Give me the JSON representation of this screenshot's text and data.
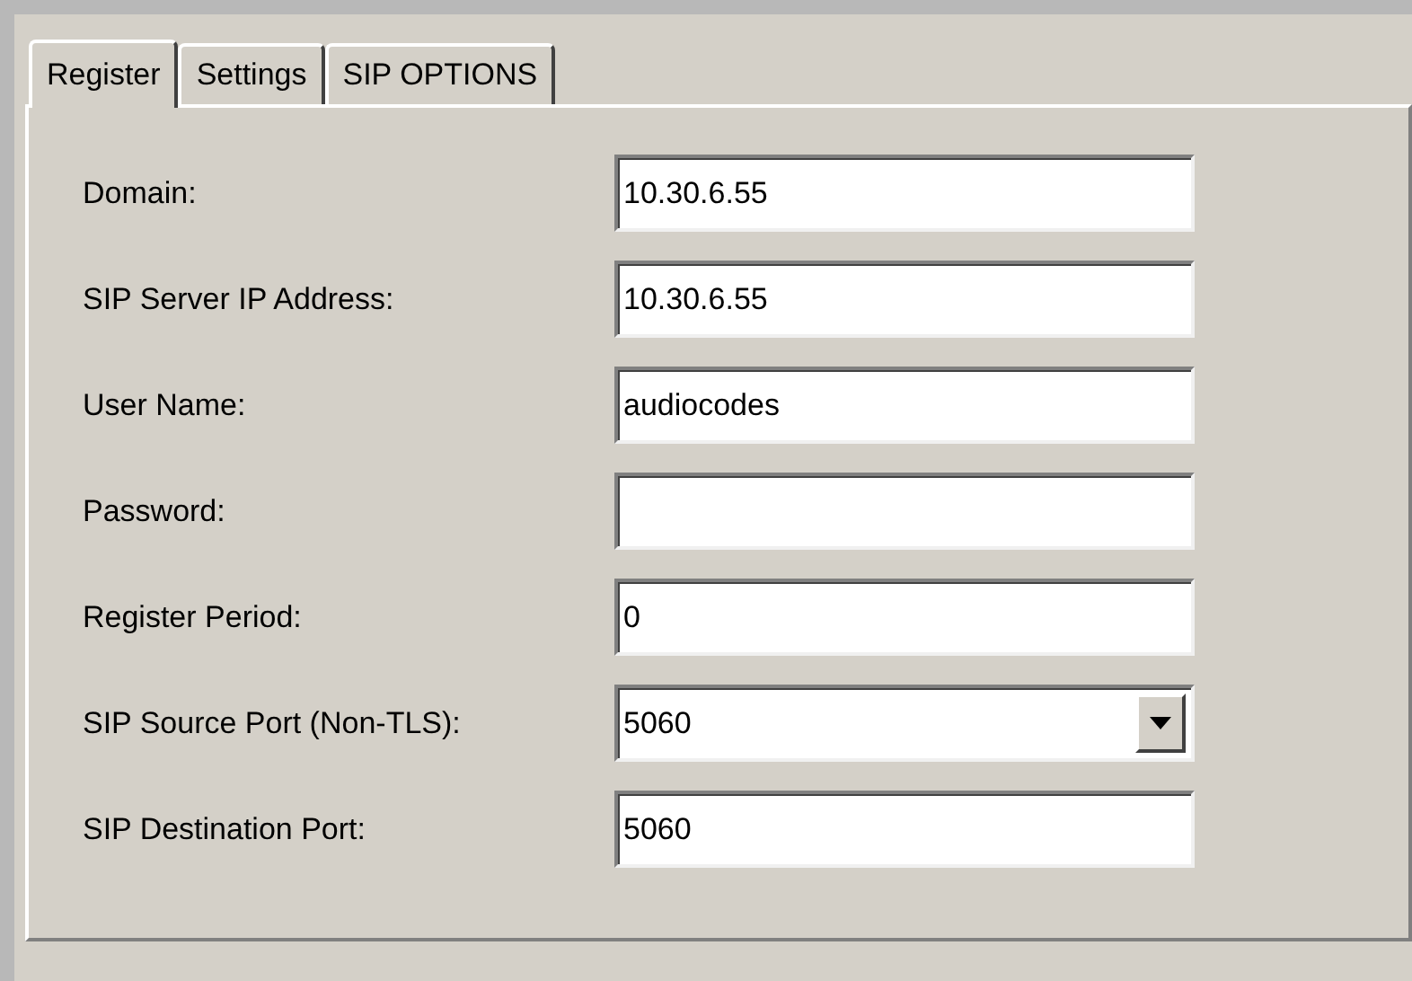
{
  "tabs": [
    {
      "label": "Register",
      "selected": true
    },
    {
      "label": "Settings",
      "selected": false
    },
    {
      "label": "SIP OPTIONS",
      "selected": false
    }
  ],
  "fields": [
    {
      "label": "Domain:",
      "value": "10.30.6.55",
      "kind": "text"
    },
    {
      "label": "SIP Server IP Address:",
      "value": "10.30.6.55",
      "kind": "text"
    },
    {
      "label": "User Name:",
      "value": "audiocodes",
      "kind": "text"
    },
    {
      "label": "Password:",
      "kind": "text"
    },
    {
      "label": "Register Period:",
      "value": "0",
      "kind": "text"
    },
    {
      "label": "SIP Source Port (Non-TLS):",
      "value": "5060",
      "kind": "dropdown"
    },
    {
      "label": "SIP Destination Port:",
      "value": "5060",
      "kind": "text"
    }
  ]
}
